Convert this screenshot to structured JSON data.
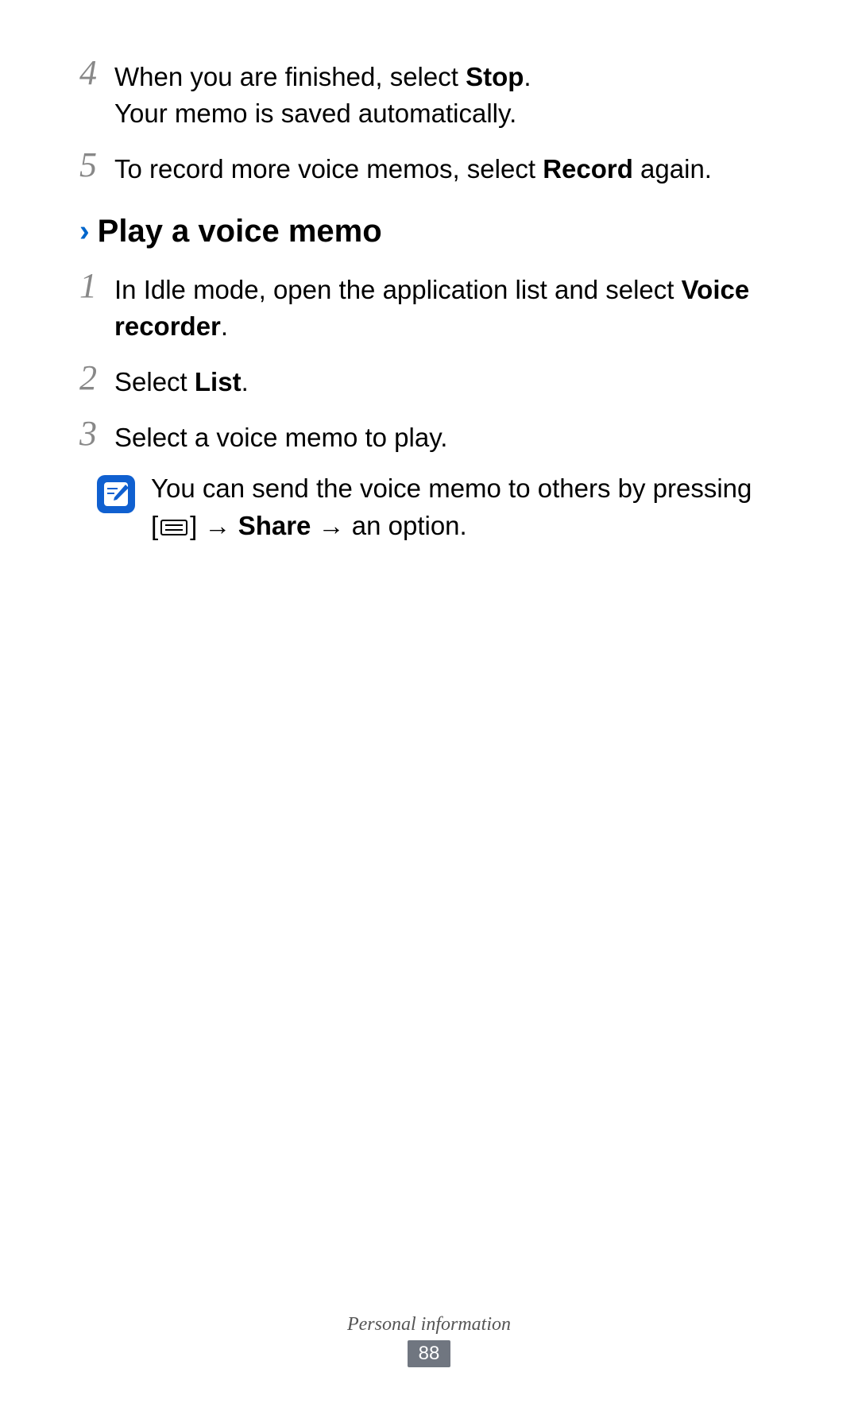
{
  "steps_before": [
    {
      "number": "4",
      "lines": [
        [
          {
            "text": "When you are finished, select ",
            "bold": false
          },
          {
            "text": "Stop",
            "bold": true
          },
          {
            "text": ".",
            "bold": false
          }
        ],
        [
          {
            "text": "Your memo is saved automatically.",
            "bold": false
          }
        ]
      ]
    },
    {
      "number": "5",
      "lines": [
        [
          {
            "text": "To record more voice memos, select ",
            "bold": false
          },
          {
            "text": "Record",
            "bold": true
          },
          {
            "text": " again.",
            "bold": false
          }
        ]
      ]
    }
  ],
  "heading": {
    "chevron": "›",
    "text": "Play a voice memo"
  },
  "steps_after": [
    {
      "number": "1",
      "lines": [
        [
          {
            "text": "In Idle mode, open the application list and select ",
            "bold": false
          },
          {
            "text": "Voice recorder",
            "bold": true
          },
          {
            "text": ".",
            "bold": false
          }
        ]
      ]
    },
    {
      "number": "2",
      "lines": [
        [
          {
            "text": "Select ",
            "bold": false
          },
          {
            "text": "List",
            "bold": true
          },
          {
            "text": ".",
            "bold": false
          }
        ]
      ]
    },
    {
      "number": "3",
      "lines": [
        [
          {
            "text": "Select a voice memo to play.",
            "bold": false
          }
        ]
      ]
    }
  ],
  "note": {
    "line1": "You can send the voice memo to others by pressing",
    "bracket_open": "[",
    "bracket_close": "]",
    "arrow": " → ",
    "share": "Share",
    "option": " an option."
  },
  "footer": {
    "section": "Personal information",
    "page": "88"
  }
}
